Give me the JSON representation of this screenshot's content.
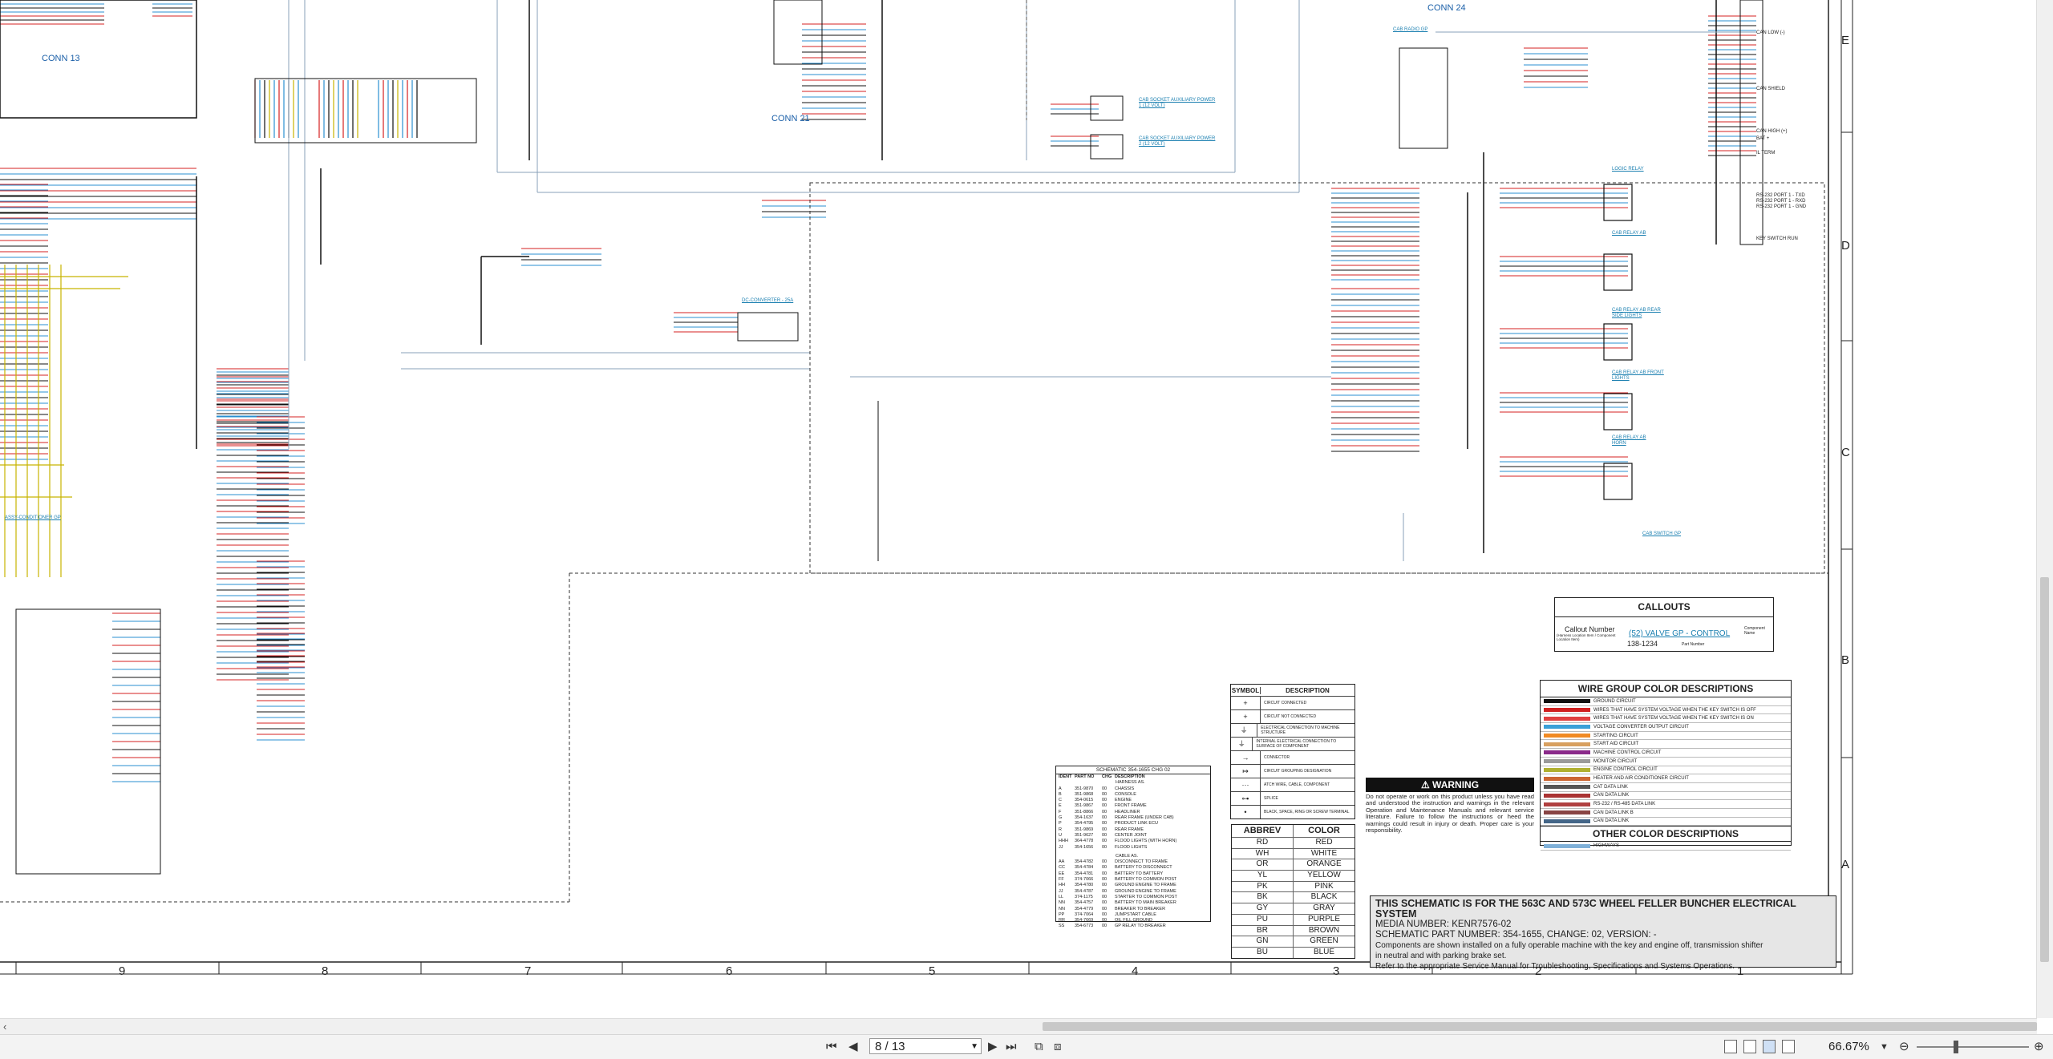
{
  "viewer": {
    "connector_labels": [
      "CONN 13",
      "CONN 21",
      "CONN 24"
    ],
    "component_links": [
      "ASSY-CONDITIONER GP",
      "DC-CONVERTER - 25A",
      "CAB SOCKET AUXILIARY POWER 1 (12 VOLT)",
      "CAB SOCKET AUXILIARY POWER 2 (12 VOLT)",
      "CAB RADIO GP",
      "LOGIC RELAY",
      "CAB RELAY AB",
      "CAB RELAY AB REAR SIDE LIGHTS",
      "CAB RELAY AB FRONT LIGHTS",
      "CAB RELAY AB HORN",
      "CAB SWITCH GP"
    ],
    "harness_labels": [
      "CAN LOW (-)",
      "CAN SHIELD",
      "CAN HIGH (+)",
      "KEY SWITCH RUN",
      "RS-232 PORT 1 - TXD",
      "RS-232 PORT 1 - RXD",
      "RS-232 PORT 1 - GND",
      "BAT +",
      "IL TERM"
    ],
    "callouts": {
      "title": "CALLOUTS",
      "callout_number_label": "Callout Number",
      "callout_sub": "(Harness Location Item / Component Location Item)",
      "example_link": "(52) VALVE GP - CONTROL",
      "part_number": "138-1234",
      "part_number_label": "Part Number",
      "component_name_label": "Component Name"
    },
    "symbol_table": {
      "headers": [
        "SYMBOL",
        "DESCRIPTION"
      ],
      "rows": [
        {
          "symbol": "+",
          "description": "CIRCUIT CONNECTED"
        },
        {
          "symbol": "+",
          "description": "CIRCUIT NOT CONNECTED"
        },
        {
          "symbol": "⏚",
          "description": "ELECTRICAL CONNECTION TO MACHINE STRUCTURE"
        },
        {
          "symbol": "⏚",
          "description": "INTERNAL ELECTRICAL CONNECTION TO SURFACE OF COMPONENT"
        },
        {
          "symbol": "→",
          "description": "CONNECTOR"
        },
        {
          "symbol": "↦",
          "description": "CIRCUIT GROUPING DESIGNATION"
        },
        {
          "symbol": "···",
          "description": "ATCH WIRE, CABLE, COMPONENT"
        },
        {
          "symbol": "⊶",
          "description": "SPLICE"
        },
        {
          "symbol": "•",
          "description": "BLACK, SPACE, RING OR SCREW TERMINAL"
        }
      ]
    },
    "color_abbrev": {
      "headers": [
        "ABBREV",
        "COLOR"
      ],
      "rows": [
        [
          "RD",
          "RED"
        ],
        [
          "WH",
          "WHITE"
        ],
        [
          "OR",
          "ORANGE"
        ],
        [
          "YL",
          "YELLOW"
        ],
        [
          "PK",
          "PINK"
        ],
        [
          "BK",
          "BLACK"
        ],
        [
          "GY",
          "GRAY"
        ],
        [
          "PU",
          "PURPLE"
        ],
        [
          "BR",
          "BROWN"
        ],
        [
          "GN",
          "GREEN"
        ],
        [
          "BU",
          "BLUE"
        ]
      ]
    },
    "wire_group": {
      "title": "WIRE GROUP COLOR DESCRIPTIONS",
      "rows": [
        {
          "color": "#111111",
          "label": "GROUND CIRCUIT"
        },
        {
          "color": "#d02020",
          "label": "WIRES THAT HAVE SYSTEM VOLTAGE WHEN THE KEY SWITCH IS OFF"
        },
        {
          "color": "#e04040",
          "label": "WIRES THAT HAVE SYSTEM VOLTAGE WHEN THE KEY SWITCH IS ON"
        },
        {
          "color": "#3aa0d8",
          "label": "VOLTAGE CONVERTER OUTPUT CIRCUIT"
        },
        {
          "color": "#f08a24",
          "label": "STARTING CIRCUIT"
        },
        {
          "color": "#d8a060",
          "label": "START AID CIRCUIT"
        },
        {
          "color": "#8a2a8a",
          "label": "MACHINE CONTROL CIRCUIT"
        },
        {
          "color": "#9a9a9a",
          "label": "MONITOR CIRCUIT"
        },
        {
          "color": "#b0b030",
          "label": "ENGINE CONTROL CIRCUIT"
        },
        {
          "color": "#cc6633",
          "label": "HEATER AND AIR CONDITIONER CIRCUIT"
        },
        {
          "color": "#555555",
          "label": "CAT DATA LINK"
        },
        {
          "color": "#aa3333",
          "label": "CAN DATA LINK"
        },
        {
          "color": "#b04040",
          "label": "RS-232 / RS-485 DATA LINK"
        },
        {
          "color": "#884444",
          "label": "CAN DATA LINK B"
        },
        {
          "color": "#446688",
          "label": "CAN DATA LINK"
        }
      ],
      "other_title": "OTHER COLOR DESCRIPTIONS",
      "other_rows": [
        {
          "color": "#7fb0d8",
          "label": "HIGHWAYS"
        }
      ]
    },
    "warning": {
      "title": "WARNING",
      "text": "Do not operate or work on this product unless you have read and understood the instruction and warnings in the relevant Operation and Maintenance Manuals and relevant service literature. Failure to follow the instructions or heed the warnings could result in injury or death. Proper care is your responsibility."
    },
    "parts_list": {
      "title": "SCHEMATIC 354-1655 CHG 02",
      "headers": [
        "IDENT",
        "PART NO",
        "CHG",
        "DESCRIPTION"
      ],
      "section1": "HARNESS AS.",
      "rows1": [
        [
          "A",
          "351-9870",
          "00",
          "CHASSIS"
        ],
        [
          "B",
          "351-9868",
          "00",
          "CONSOLE"
        ],
        [
          "C",
          "354-0615",
          "00",
          "ENGINE"
        ],
        [
          "E",
          "351-9867",
          "00",
          "FRONT FRAME"
        ],
        [
          "F",
          "351-8866",
          "00",
          "HEADLINER"
        ],
        [
          "G",
          "354-1637",
          "00",
          "REAR FRAME (UNDER CAB)"
        ],
        [
          "P",
          "354-4795",
          "00",
          "PRODUCT LINK ECU"
        ],
        [
          "R",
          "351-9869",
          "00",
          "REAR FRAME"
        ],
        [
          "U",
          "351-9627",
          "00",
          "CENTER JOINT"
        ],
        [
          "HHH",
          "364-4778",
          "00",
          "FLOOD LIGHTS (WITH HORN)"
        ],
        [
          "JJ",
          "354-1656",
          "00",
          "FLOOD LIGHTS"
        ]
      ],
      "section2": "CABLE AS.",
      "rows2": [
        [
          "AA",
          "354-4782",
          "00",
          "DISCONNECT TO FRAME"
        ],
        [
          "CC",
          "354-4784",
          "00",
          "BATTERY TO DISCONNECT"
        ],
        [
          "EE",
          "354-4781",
          "00",
          "BATTERY TO BATTERY"
        ],
        [
          "FF",
          "374-7066",
          "00",
          "BATTERY TO COMMON POST"
        ],
        [
          "HH",
          "354-4780",
          "00",
          "GROUND ENGINE TO FRAME"
        ],
        [
          "JJ",
          "354-4787",
          "00",
          "GROUND ENGINE TO FRAME"
        ],
        [
          "LL",
          "374-1175",
          "00",
          "STARTER TO COMMON POST"
        ],
        [
          "NN",
          "354-4757",
          "00",
          "BATTERY TO MAIN BREAKER"
        ],
        [
          "NN",
          "354-4779",
          "00",
          "BREAKER TO BREAKER"
        ],
        [
          "PP",
          "374-7064",
          "00",
          "JUMPSTART CABLE"
        ],
        [
          "RR",
          "354-7669",
          "00",
          "OIL FILL GROUND"
        ],
        [
          "SS",
          "354-6773",
          "00",
          "GP RELAY TO BREAKER"
        ]
      ]
    },
    "title_block": {
      "main": "THIS SCHEMATIC IS FOR THE 563C AND 573C WHEEL FELLER BUNCHER ELECTRICAL SYSTEM",
      "media": "MEDIA NUMBER: KENR7576-02",
      "part": "SCHEMATIC PART NUMBER: 354-1655, CHANGE: 02, VERSION: -",
      "note1": "Components are shown installed on a fully operable machine with the key and engine off, transmission shifter",
      "note2": "in neutral and with parking brake set.",
      "note3": "Refer to the appropriate Service Manual for Troubleshooting, Specifications and Systems Operations."
    },
    "grid_columns": [
      "9",
      "8",
      "7",
      "6",
      "5",
      "4",
      "3",
      "2",
      "1"
    ],
    "grid_rows": [
      "E",
      "D",
      "C",
      "B",
      "A"
    ]
  },
  "statusbar": {
    "page_value": "8 / 13",
    "zoom": "66.67%"
  },
  "colors": {
    "wire_red": "#d42020",
    "wire_blue": "#2a8fd0",
    "wire_black": "#111111",
    "wire_yellow": "#c8b400",
    "link_blue": "#1a7fb0",
    "harness_gray": "#88a0b8"
  }
}
